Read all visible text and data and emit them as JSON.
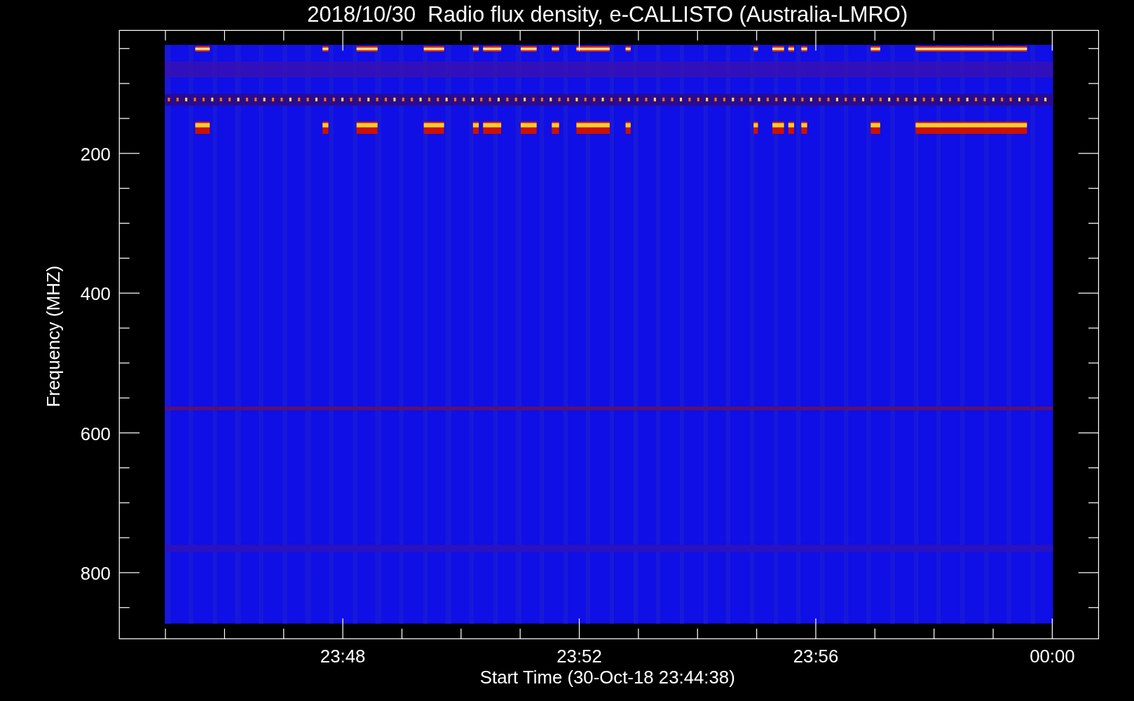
{
  "plot": {
    "title": "2018/10/30  Radio flux density, e-CALLISTO (Australia-LMRO)",
    "ylabel": "Frequency (MHZ)",
    "xlabel": "Start Time (30-Oct-18 23:44:38)",
    "yticks": [
      "200",
      "400",
      "600",
      "800"
    ],
    "xticks": [
      "23:48",
      "23:52",
      "23:56",
      "00:00"
    ]
  }
}
